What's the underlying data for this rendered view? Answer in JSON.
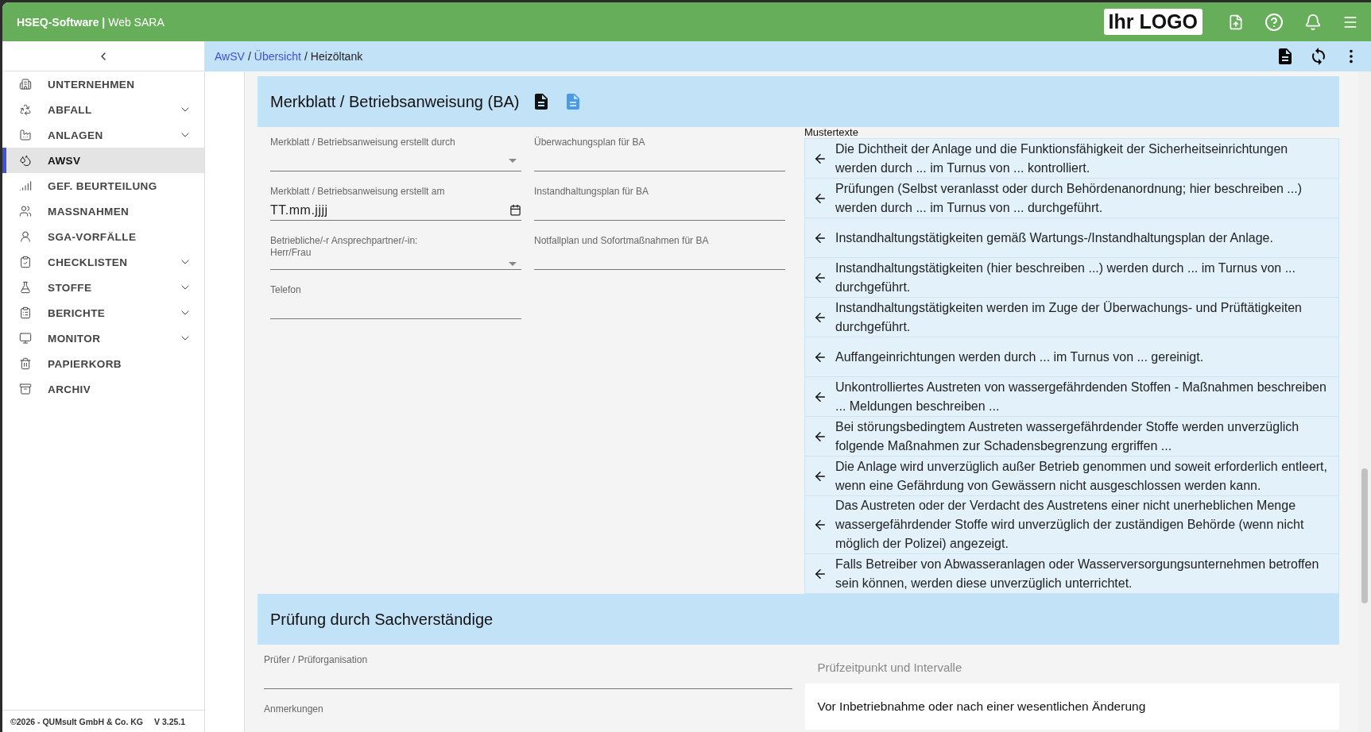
{
  "header": {
    "brand": "**HSEQ-Software |** Web SARA",
    "logo": "Ihr LOGO"
  },
  "sidebar": {
    "items": [
      {
        "label": "UNTERNEHMEN",
        "selected": false,
        "expandable": false
      },
      {
        "label": "ABFALL",
        "selected": false,
        "expandable": true
      },
      {
        "label": "ANLAGEN",
        "selected": false,
        "expandable": true
      },
      {
        "label": "AWSV",
        "selected": true,
        "expandable": false
      },
      {
        "label": "GEF. BEURTEILUNG",
        "selected": false,
        "expandable": false
      },
      {
        "label": "MASSNAHMEN",
        "selected": false,
        "expandable": false
      },
      {
        "label": "SGA-VORFÄLLE",
        "selected": false,
        "expandable": false
      },
      {
        "label": "CHECKLISTEN",
        "selected": false,
        "expandable": true
      },
      {
        "label": "STOFFE",
        "selected": false,
        "expandable": true
      },
      {
        "label": "BERICHTE",
        "selected": false,
        "expandable": true
      },
      {
        "label": "MONITOR",
        "selected": false,
        "expandable": true
      },
      {
        "label": "PAPIERKORB",
        "selected": false,
        "expandable": false
      },
      {
        "label": "ARCHIV",
        "selected": false,
        "expandable": false
      }
    ],
    "copyright": "©2026 - QUMsult GmbH & Co. KG",
    "version": "V 3.25.1"
  },
  "breadcrumb": [
    {
      "label": "AwSV",
      "link": true
    },
    {
      "separator": "/",
      "label": "Übersicht",
      "link": true
    },
    {
      "separator": "/",
      "label": "Heizöltank",
      "link": false
    }
  ],
  "section_ba": {
    "title": "Merkblatt / Betriebsanweisung (BA)",
    "fields_left": [
      {
        "kind": "select",
        "label": "Merkblatt / Betriebsanweisung erstellt durch"
      },
      {
        "kind": "date",
        "label": "Merkblatt / Betriebsanweisung erstellt am",
        "placeholder": "TT.mm.jjjj"
      },
      {
        "kind": "select",
        "label": "Betriebliche/-r Ansprechpartner/-in:\nHerr/Frau"
      },
      {
        "kind": "text",
        "label": "Telefon"
      }
    ],
    "fields_right": [
      {
        "kind": "text",
        "label": "Überwachungsplan für BA"
      },
      {
        "kind": "text",
        "label": "Instandhaltungsplan für BA"
      },
      {
        "kind": "text",
        "label": "Notfallplan und Sofortmaßnahmen für BA"
      }
    ],
    "mustertexte": {
      "label": "Mustertexte",
      "items": [
        "Die Dichtheit der Anlage und die Funktionsfähigkeit der Sicherheitseinrichtungen werden durch ... im Turnus von ... kontrolliert.",
        "Prüfungen (Selbst veranlasst oder durch Behördenanordnung; hier beschreiben ...) werden durch ... im Turnus von ... durchgeführt.",
        "Instandhaltungstätigkeiten gemäß Wartungs-/Instandhaltungsplan der Anlage.",
        "Instandhaltungstätigkeiten (hier beschreiben ...) werden durch ... im Turnus von ... durchgeführt.",
        "Instandhaltungstätigkeiten werden im Zuge der Überwachungs- und Prüftätigkeiten durchgeführt.",
        "Auffangeinrichtungen werden durch ... im Turnus von ... gereinigt.",
        "Unkontrolliertes Austreten von wassergefährdenden Stoffen - Maßnahmen beschreiben ... Meldungen beschreiben ...",
        "Bei störungsbedingtem Austreten wassergefährdender Stoffe werden unverzüglich folgende Maßnahmen zur Schadensbegrenzung ergriffen ...",
        "Die Anlage wird unverzüglich außer Betrieb genommen und soweit erforderlich entleert, wenn eine Gefährdung von Gewässern nicht ausgeschlossen werden kann.",
        "Das Austreten oder der Verdacht des Austretens einer nicht unerheblichen Menge wassergefährdender Stoffe wird unverzüglich der zuständigen Behörde (wenn nicht möglich der Polizei) angezeigt.",
        "Falls Betreiber von Abwasseranlagen oder Wasserversorgungsunternehmen betroffen sein können, werden diese unverzüglich unterrichtet."
      ]
    }
  },
  "section_pruefung": {
    "title": "Prüfung durch Sachverständige",
    "fields_left": [
      {
        "kind": "text",
        "label": "Prüfer / Prüforganisation"
      },
      {
        "kind": "label_only",
        "label": "Anmerkungen"
      }
    ],
    "intervals": {
      "title": "Prüfzeitpunkt und Intervalle",
      "items": [
        "Vor Inbetriebnahme oder nach einer wesentlichen Änderung"
      ]
    }
  }
}
